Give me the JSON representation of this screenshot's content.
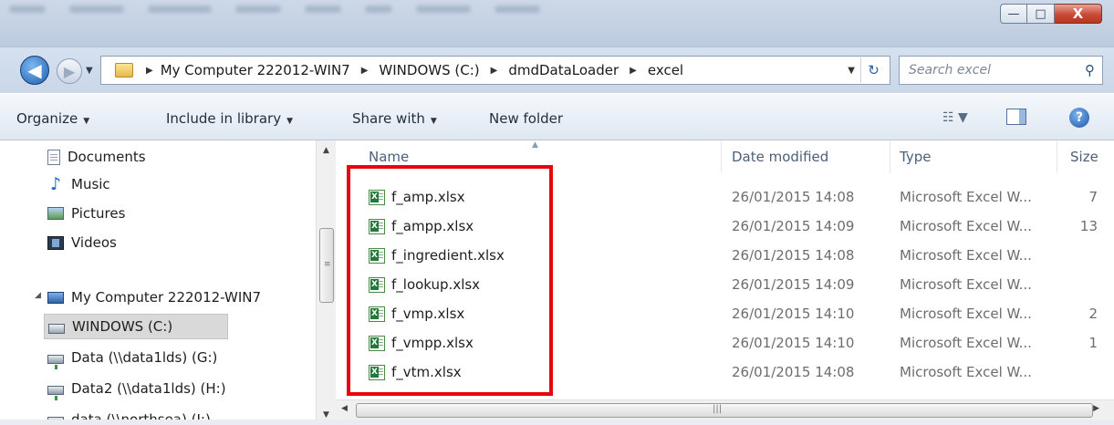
{
  "window": {
    "minimize_glyph": "—",
    "maximize_glyph": "□",
    "close_glyph": "X"
  },
  "address": {
    "crumbs": [
      "My Computer 222012-WIN7",
      "WINDOWS (C:)",
      "dmdDataLoader",
      "excel"
    ],
    "search_placeholder": "Search excel"
  },
  "toolbar": {
    "organize": "Organize",
    "include_in_library": "Include in library",
    "share_with": "Share with",
    "new_folder": "New folder"
  },
  "nav": {
    "items": [
      {
        "label": "Documents",
        "icon": "documents-icon"
      },
      {
        "label": "Music",
        "icon": "music-icon"
      },
      {
        "label": "Pictures",
        "icon": "pictures-icon"
      },
      {
        "label": "Videos",
        "icon": "videos-icon"
      },
      {
        "label": "My Computer 222012-WIN7",
        "icon": "computer-icon"
      },
      {
        "label": "WINDOWS (C:)",
        "icon": "drive-icon",
        "selected": true
      },
      {
        "label": "Data (\\\\data1lds) (G:)",
        "icon": "network-drive-icon"
      },
      {
        "label": "Data2 (\\\\data1lds) (H:)",
        "icon": "network-drive-icon"
      },
      {
        "label": "data (\\\\northsea) (I:)",
        "icon": "network-drive-icon"
      }
    ]
  },
  "columns": {
    "name": "Name",
    "date": "Date modified",
    "type": "Type",
    "size": "Size"
  },
  "files": [
    {
      "name": "f_amp.xlsx",
      "date": "26/01/2015 14:08",
      "type": "Microsoft Excel W...",
      "size": "7"
    },
    {
      "name": "f_ampp.xlsx",
      "date": "26/01/2015 14:09",
      "type": "Microsoft Excel W...",
      "size": "13"
    },
    {
      "name": "f_ingredient.xlsx",
      "date": "26/01/2015 14:08",
      "type": "Microsoft Excel W...",
      "size": ""
    },
    {
      "name": "f_lookup.xlsx",
      "date": "26/01/2015 14:09",
      "type": "Microsoft Excel W...",
      "size": ""
    },
    {
      "name": "f_vmp.xlsx",
      "date": "26/01/2015 14:10",
      "type": "Microsoft Excel W...",
      "size": "2"
    },
    {
      "name": "f_vmpp.xlsx",
      "date": "26/01/2015 14:10",
      "type": "Microsoft Excel W...",
      "size": "1"
    },
    {
      "name": "f_vtm.xlsx",
      "date": "26/01/2015 14:08",
      "type": "Microsoft Excel W...",
      "size": ""
    }
  ],
  "colors": {
    "highlight": "#e8050b",
    "selected_nav": "#d9d9d9"
  }
}
